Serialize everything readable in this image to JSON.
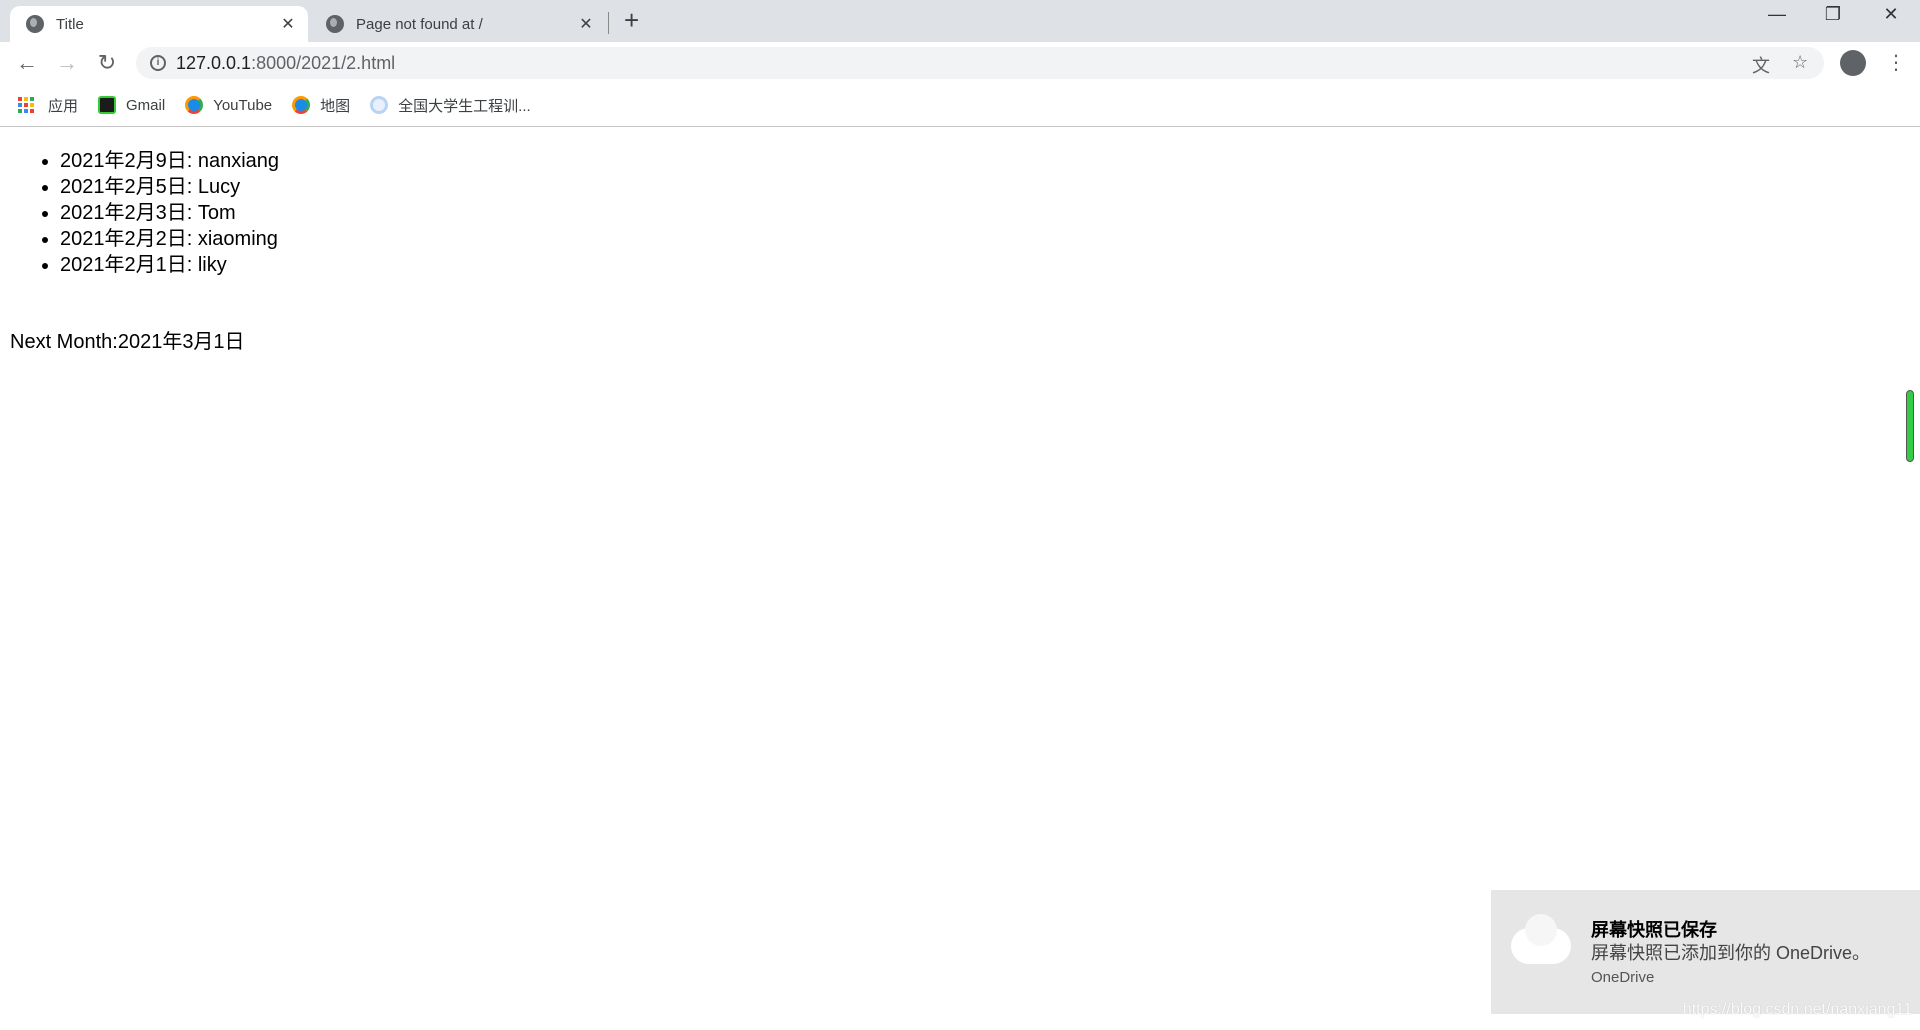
{
  "tabs": [
    {
      "title": "Title",
      "active": true
    },
    {
      "title": "Page not found at /",
      "active": false
    }
  ],
  "address": {
    "host": "127.0.0.1",
    "rest": ":8000/2021/2.html"
  },
  "bookmarks": [
    {
      "label": "应用",
      "icon": "apps-grid-icon"
    },
    {
      "label": "Gmail",
      "icon": "pycharm-icon"
    },
    {
      "label": "YouTube",
      "icon": "qq-browser-icon"
    },
    {
      "label": "地图",
      "icon": "qq-browser-icon"
    },
    {
      "label": "全国大学生工程训...",
      "icon": "site-icon"
    }
  ],
  "list": [
    "2021年2月9日: nanxiang",
    "2021年2月5日: Lucy",
    "2021年2月3日: Tom",
    "2021年2月2日: xiaoming",
    "2021年2月1日: liky"
  ],
  "next_month": "Next Month:2021年3月1日",
  "toast": {
    "title": "屏幕快照已保存",
    "body": "屏幕快照已添加到你的 OneDrive。",
    "source": "OneDrive"
  },
  "watermark": "https://blog.csdn.net/nanxiang11"
}
